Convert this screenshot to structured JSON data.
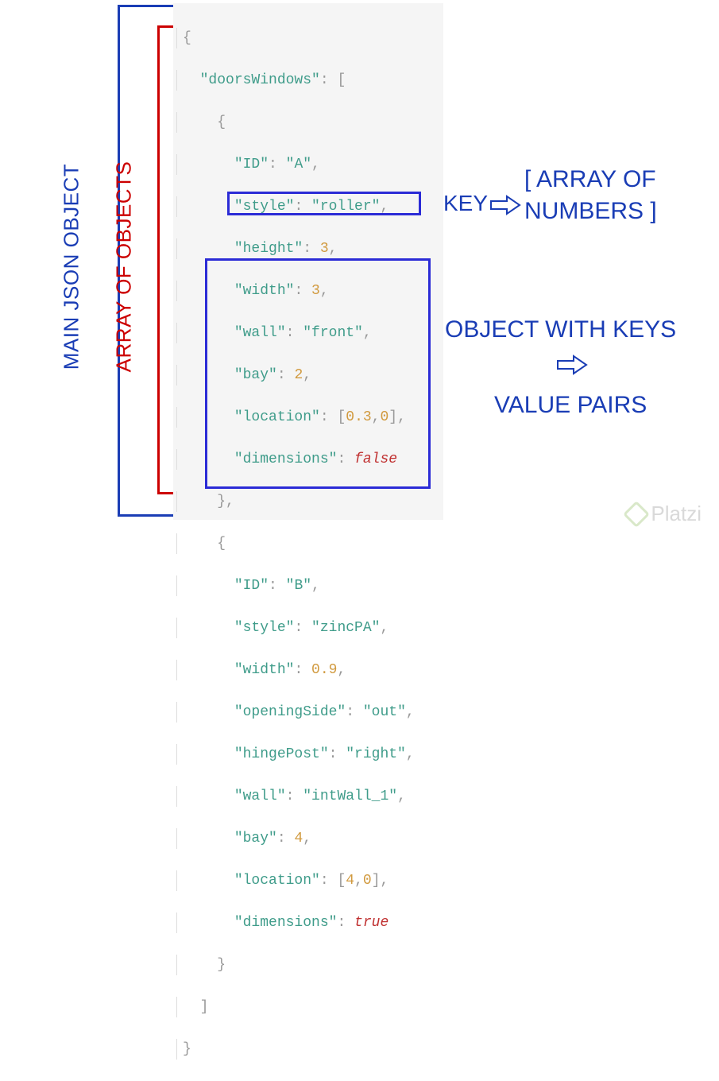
{
  "labels": {
    "main": "MAIN JSON OBJECT",
    "array": "ARRAY OF OBJECTS",
    "key": "KEY",
    "arrayOfNumbers1": "[ ARRAY OF",
    "arrayOfNumbers2": "NUMBERS ]",
    "objWithKeys": "OBJECT WITH KEYS",
    "valuePairs": "VALUE PAIRS"
  },
  "code": {
    "l0": "{",
    "key_doorsWindows": "\"doorsWindows\"",
    "colon": ": ",
    "arr_open": "[",
    "obj_open": "{",
    "obj_close": "}",
    "arr_close": "]",
    "close_brace": "}",
    "comma": ",",
    "k_id": "\"ID\"",
    "v_A": "\"A\"",
    "k_style": "\"style\"",
    "v_roller": "\"roller\"",
    "k_height": "\"height\"",
    "n_3a": "3",
    "k_width": "\"width\"",
    "n_3b": "3",
    "k_wall": "\"wall\"",
    "v_front": "\"front\"",
    "k_bay": "\"bay\"",
    "n_2": "2",
    "k_location": "\"location\"",
    "loc1_a": "0.3",
    "loc1_b": "0",
    "k_dimensions": "\"dimensions\"",
    "b_false": "false",
    "v_B": "\"B\"",
    "v_zincPA": "\"zincPA\"",
    "n_09": "0.9",
    "k_openingSide": "\"openingSide\"",
    "v_out": "\"out\"",
    "k_hingePost": "\"hingePost\"",
    "v_right": "\"right\"",
    "v_intWall": "\"intWall_1\"",
    "n_4": "4",
    "loc2_a": "4",
    "loc2_b": "0",
    "b_true": "true"
  },
  "watermark": "Platzi"
}
